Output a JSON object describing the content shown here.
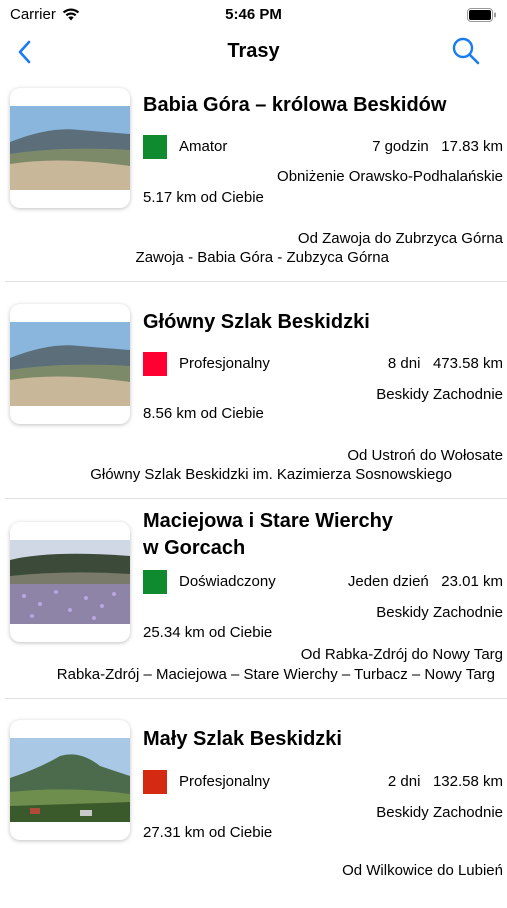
{
  "status_bar": {
    "carrier": "Carrier",
    "time": "5:46 PM"
  },
  "nav": {
    "title": "Trasy"
  },
  "routes": [
    {
      "title": "Babia Góra – królowa Beskidów",
      "level": "Amator",
      "level_color": "#0f8a2e",
      "duration": "7 godzin",
      "length": "17.83 km",
      "region": "Obniżenie Orawsko-Podhalańskie",
      "distance": "5.17 km od Ciebie",
      "from_to": "Od Zawoja do Zubrzyca Górna",
      "waypoints": "Zawoja - Babia Góra - Zubzyca Górna"
    },
    {
      "title": "Główny Szlak Beskidzki",
      "level": "Profesjonalny",
      "level_color": "#ff0033",
      "duration": "8 dni",
      "length": "473.58 km",
      "region": "Beskidy Zachodnie",
      "distance": "8.56 km od Ciebie",
      "from_to": "Od Ustroń do Wołosate",
      "waypoints": "Główny Szlak Beskidzki im. Kazimierza Sosnowskiego"
    },
    {
      "title": "Maciejowa i Stare Wierchy w Gorcach",
      "title_line1": "Maciejowa i Stare Wierchy",
      "title_line2": "w Gorcach",
      "level": "Doświadczony",
      "level_color": "#0f8a2e",
      "duration": "Jeden dzień",
      "length": "23.01 km",
      "region": "Beskidy Zachodnie",
      "distance": "25.34 km od Ciebie",
      "from_to": "Od Rabka-Zdrój do Nowy Targ",
      "waypoints": "Rabka-Zdrój – Maciejowa – Stare Wierchy – Turbacz – Nowy Targ"
    },
    {
      "title": "Mały Szlak Beskidzki",
      "level": "Profesjonalny",
      "level_color": "#d42a12",
      "duration": "2 dni",
      "length": "132.58 km",
      "region": "Beskidy Zachodnie",
      "distance": "27.31 km od Ciebie",
      "from_to": "Od Wilkowice do Lubień"
    }
  ],
  "colors": {
    "accent": "#1a7cf5"
  },
  "icons": {
    "back": "chevron-left-icon",
    "search": "search-icon",
    "wifi": "wifi-icon",
    "battery": "battery-icon"
  }
}
